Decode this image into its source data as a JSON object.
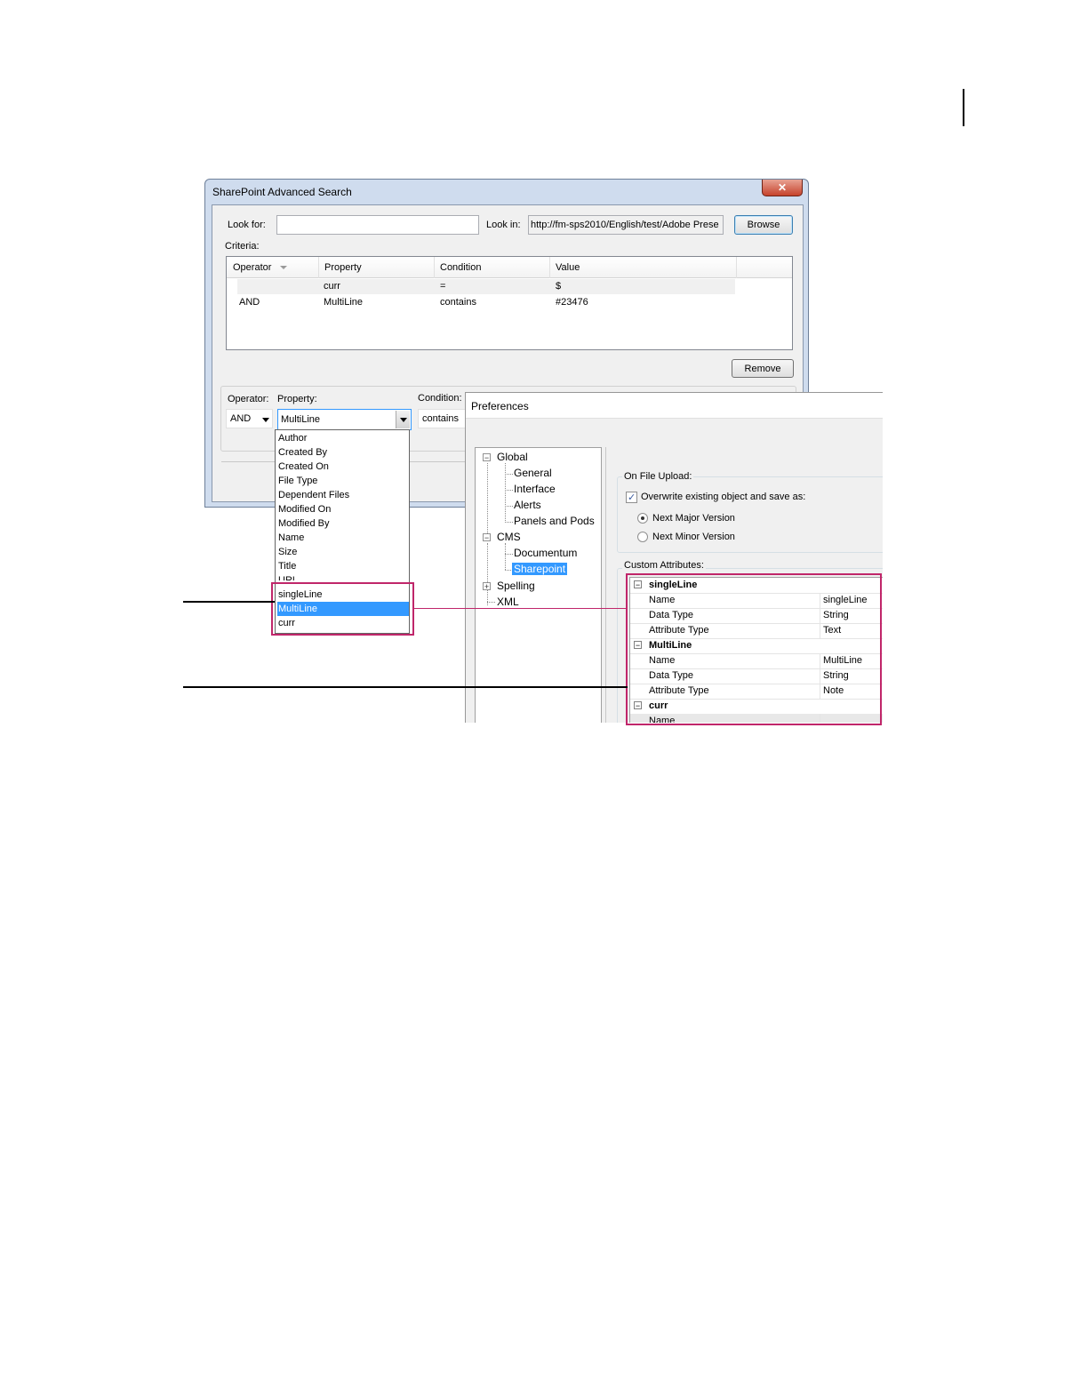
{
  "search_dialog": {
    "title": "SharePoint Advanced Search",
    "close_glyph": "✕",
    "look_for_label": "Look for:",
    "look_for_value": "",
    "look_in_label": "Look in:",
    "look_in_value": "http://fm-sps2010/English/test/Adobe Prese",
    "browse_label": "Browse",
    "criteria_label": "Criteria:",
    "columns": [
      "Operator",
      "Property",
      "Condition",
      "Value"
    ],
    "rows": [
      {
        "operator": "",
        "property": "curr",
        "condition": "=",
        "value": "$"
      },
      {
        "operator": "AND",
        "property": "MultiLine",
        "condition": "contains",
        "value": "#23476"
      }
    ],
    "remove_label": "Remove",
    "operator_label": "Operator:",
    "operator_value": "AND",
    "property_label": "Property:",
    "property_value": "MultiLine",
    "condition_label": "Condition:",
    "condition_value": "contains",
    "property_options": [
      "Author",
      "Created By",
      "Created On",
      "File Type",
      "Dependent Files",
      "Modified On",
      "Modified By",
      "Name",
      "Size",
      "Title",
      "URL",
      "singleLine",
      "MultiLine",
      "curr"
    ]
  },
  "preferences": {
    "title": "Preferences",
    "tree": {
      "global": "Global",
      "general": "General",
      "interface": "Interface",
      "alerts": "Alerts",
      "panels": "Panels and Pods",
      "cms": "CMS",
      "documentum": "Documentum",
      "sharepoint": "Sharepoint",
      "spelling": "Spelling",
      "xml": "XML"
    },
    "on_file_upload_label": "On File Upload:",
    "overwrite_label": "Overwrite existing object and save as:",
    "overwrite_checked": true,
    "next_major_label": "Next Major Version",
    "next_minor_label": "Next Minor Version",
    "selected_version": "Next Major Version",
    "custom_attributes_label": "Custom Attributes:",
    "attributes": [
      {
        "name": "singleLine",
        "props": [
          {
            "key": "Name",
            "value": "singleLine"
          },
          {
            "key": "Data Type",
            "value": "String"
          },
          {
            "key": "Attribute Type",
            "value": "Text"
          }
        ]
      },
      {
        "name": "MultiLine",
        "props": [
          {
            "key": "Name",
            "value": "MultiLine"
          },
          {
            "key": "Data Type",
            "value": "String"
          },
          {
            "key": "Attribute Type",
            "value": "Note"
          }
        ]
      },
      {
        "name": "curr",
        "props": [
          {
            "key": "Name",
            "value": ""
          }
        ]
      }
    ]
  },
  "colors": {
    "highlight": "#c0266a",
    "selection": "#3399ff"
  }
}
